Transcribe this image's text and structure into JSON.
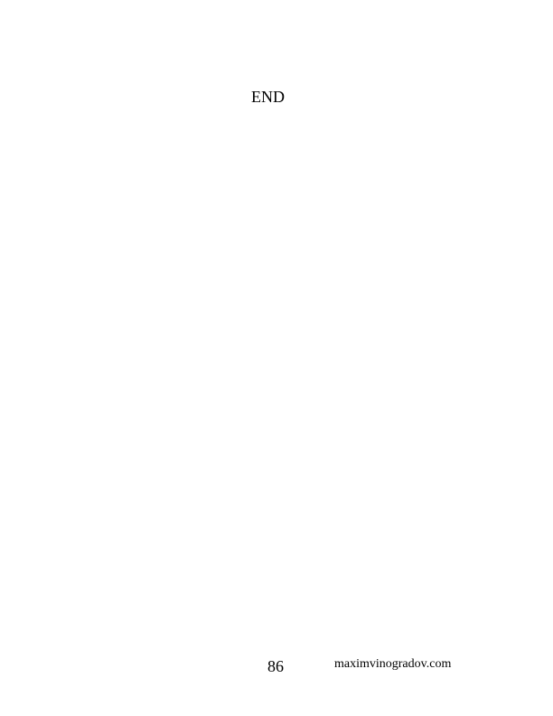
{
  "body": {
    "end_text": "END"
  },
  "footer": {
    "page_number": "86",
    "website": "maximvinogradov.com"
  }
}
